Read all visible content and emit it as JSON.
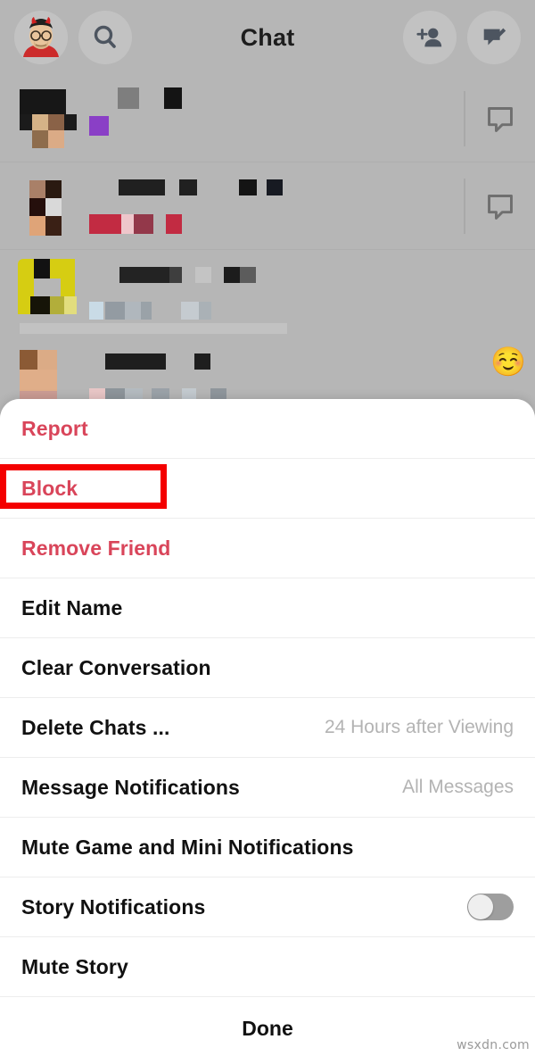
{
  "header": {
    "title": "Chat",
    "avatar_name": "bitmoji-avatar",
    "search_icon": "search-icon",
    "add_friend_icon": "add-friend-icon",
    "new_chat_icon": "new-chat-icon"
  },
  "chat_list": {
    "rows": [
      {
        "name_censored": true,
        "preview_censored": true,
        "status_icon": "chat-bubble-icon"
      },
      {
        "name_censored": true,
        "preview_censored": true,
        "status_icon": "chat-bubble-icon"
      },
      {
        "name_censored": true,
        "preview_censored": true,
        "status_icon": ""
      },
      {
        "name_censored": true,
        "preview_censored": true,
        "status_icon": "",
        "emoji": "☺️"
      }
    ]
  },
  "action_sheet": {
    "items": [
      {
        "label": "Report",
        "style": "danger",
        "value": "",
        "control": "none"
      },
      {
        "label": "Block",
        "style": "danger",
        "value": "",
        "control": "none"
      },
      {
        "label": "Remove Friend",
        "style": "danger",
        "value": "",
        "control": "none"
      },
      {
        "label": "Edit Name",
        "style": "normal",
        "value": "",
        "control": "none"
      },
      {
        "label": "Clear Conversation",
        "style": "normal",
        "value": "",
        "control": "none"
      },
      {
        "label": "Delete Chats ...",
        "style": "normal",
        "value": "24 Hours after Viewing",
        "control": "none"
      },
      {
        "label": "Message Notifications",
        "style": "normal",
        "value": "All Messages",
        "control": "none"
      },
      {
        "label": "Mute Game and Mini Notifications",
        "style": "normal",
        "value": "",
        "control": "none"
      },
      {
        "label": "Story Notifications",
        "style": "normal",
        "value": "",
        "control": "toggle",
        "toggle_on": false
      },
      {
        "label": "Mute Story",
        "style": "normal",
        "value": "",
        "control": "none"
      }
    ],
    "done_label": "Done"
  },
  "annotation": {
    "target_label": "Block",
    "color": "#f40000"
  },
  "watermark": {
    "text": "wsxdn.com"
  },
  "colors": {
    "backdrop": "#b6b6b6",
    "sheet": "#ffffff",
    "danger": "#d9455a",
    "value_text": "#b3b3b3",
    "annotation": "#f40000"
  }
}
